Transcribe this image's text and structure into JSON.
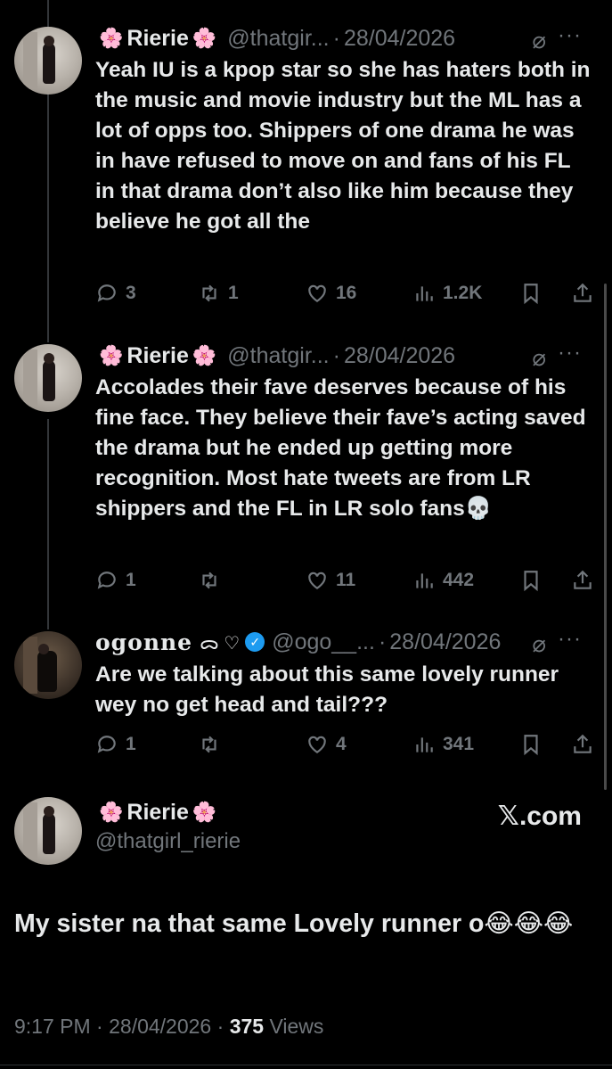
{
  "tweets": [
    {
      "name": "Rierie",
      "flower": "🌸",
      "handle": "@thatgir...",
      "date": "28/04/2026",
      "text": "Yeah IU is a kpop star so she has haters both in the music and movie industry but the ML has a lot of opps too. Shippers of one drama he was in have refused to move on and fans of his FL in that drama don’t also like him because they believe he got all the",
      "replies": "3",
      "reposts": "1",
      "likes": "16",
      "views": "1.2K"
    },
    {
      "name": "Rierie",
      "flower": "🌸",
      "handle": "@thatgir...",
      "date": "28/04/2026",
      "text": "Accolades their fave deserves because of his fine face. They believe their fave’s acting saved the drama but he ended up getting more recognition. Most hate tweets are from LR shippers and the FL in LR solo fans💀",
      "replies": "1",
      "reposts": "",
      "likes": "11",
      "views": "442"
    },
    {
      "name": "ogonne",
      "name_suffix": "ᯅ ♡",
      "handle": "@ogo__...",
      "date": "28/04/2026",
      "text": "Are we talking about this same lovely runner wey no get head and tail???",
      "replies": "1",
      "reposts": "",
      "likes": "4",
      "views": "341"
    }
  ],
  "main": {
    "name": "Rierie",
    "flower": "🌸",
    "handle": "@thatgirl_rierie",
    "source": "𝕏.com",
    "text": "My sister na that same Lovely runner o😂😂😂",
    "time": "9:17 PM",
    "date": "28/04/2026",
    "views_count": "375",
    "views_label": "Views"
  },
  "ui": {
    "dot": "·",
    "more": "···",
    "grok_icon": "⌀",
    "verified_icon": "✓"
  },
  "colors": {
    "background": "#000000",
    "text": "#e7e9ea",
    "muted": "#71767b",
    "verified": "#1d9bf0"
  }
}
